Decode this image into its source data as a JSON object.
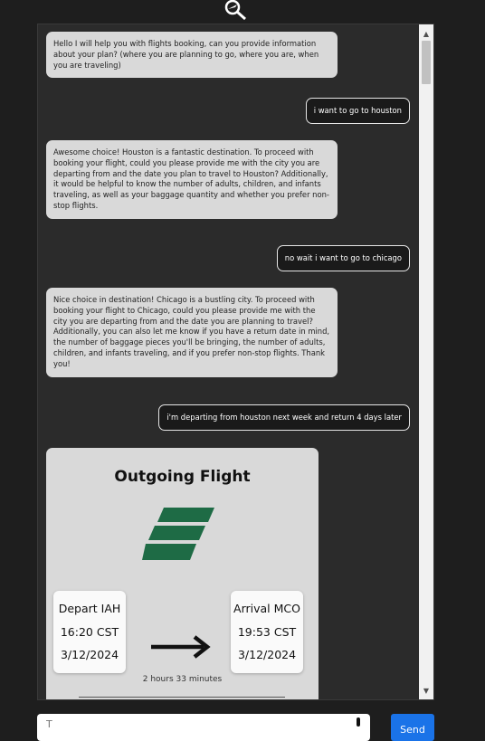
{
  "chat": {
    "messages": [
      {
        "sender": "bot",
        "text": "Hello I will help you with flights booking, can you provide information about your plan? (where you are planning to go, where you are, when you are traveling)"
      },
      {
        "sender": "user",
        "text": "i want to go to houston"
      },
      {
        "sender": "bot",
        "text": "Awesome choice! Houston is a fantastic destination. To proceed with booking your flight, could you please provide me with the city you are departing from and the date you plan to travel to Houston? Additionally, it would be helpful to know the number of adults, children, and infants traveling, as well as your baggage quantity and whether you prefer non-stop flights."
      },
      {
        "sender": "user",
        "text": "no wait i want to go to chicago"
      },
      {
        "sender": "bot",
        "text": "Nice choice in destination! Chicago is a bustling city. To proceed with booking your flight to Chicago, could you please provide me with the city you are departing from and the date you are planning to travel? Additionally, you can also let me know if you have a return date in mind, the number of baggage pieces you'll be bringing, the number of adults, children, and infants traveling, and if you prefer non-stop flights. Thank you!"
      },
      {
        "sender": "user",
        "text": "i'm departing from houston next week and return 4 days later"
      }
    ]
  },
  "flight_card": {
    "title": "Outgoing Flight",
    "depart": {
      "label": "Depart IAH",
      "time": "16:20 CST",
      "date": "3/12/2024"
    },
    "arrival": {
      "label": "Arrival MCO",
      "time": "19:53 CST",
      "date": "3/12/2024"
    },
    "duration": "2 hours 33 minutes",
    "brand_color": "#1e6b45"
  },
  "composer": {
    "placeholder": "T",
    "value": ""
  },
  "send": {
    "label": "Send"
  },
  "icons": {
    "logo": "magnifier-plane-icon",
    "mic": "microphone-icon",
    "arrow": "right-arrow-icon"
  }
}
